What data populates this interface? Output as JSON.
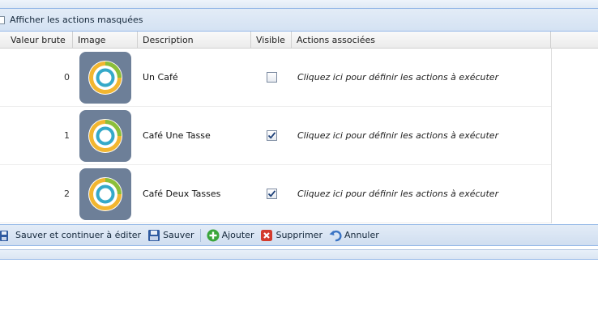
{
  "show_hidden": {
    "label": "Afficher les actions masquées",
    "checked": false
  },
  "grid": {
    "headers": {
      "raw": "Valeur brute",
      "image": "Image",
      "description": "Description",
      "visible": "Visible",
      "actions": "Actions associées"
    },
    "rows": [
      {
        "raw": "0",
        "description": "Un Café",
        "visible": false,
        "actions": "Cliquez ici pour définir les actions à exécuter",
        "icon": "coffee-ring-icon"
      },
      {
        "raw": "1",
        "description": "Café Une Tasse",
        "visible": true,
        "actions": "Cliquez ici pour définir les actions à exécuter",
        "icon": "coffee-ring-icon"
      },
      {
        "raw": "2",
        "description": "Café Deux Tasses",
        "visible": true,
        "actions": "Cliquez ici pour définir les actions à exécuter",
        "icon": "coffee-ring-icon"
      }
    ]
  },
  "toolbar": {
    "save_continue": "Sauver et continuer à éditer",
    "save": "Sauver",
    "add": "Ajouter",
    "delete": "Supprimer",
    "cancel": "Annuler"
  },
  "colors": {
    "header_blue": "#d4e2f3",
    "border_blue": "#99bbe8",
    "icon_bg": "#6d7f98",
    "ring_yellow": "#f2b630",
    "ring_green": "#8bbf3a",
    "ring_teal": "#35a9c9",
    "add_green": "#3aa53a",
    "delete_red": "#d33a2c",
    "undo_blue": "#3b74c4"
  }
}
